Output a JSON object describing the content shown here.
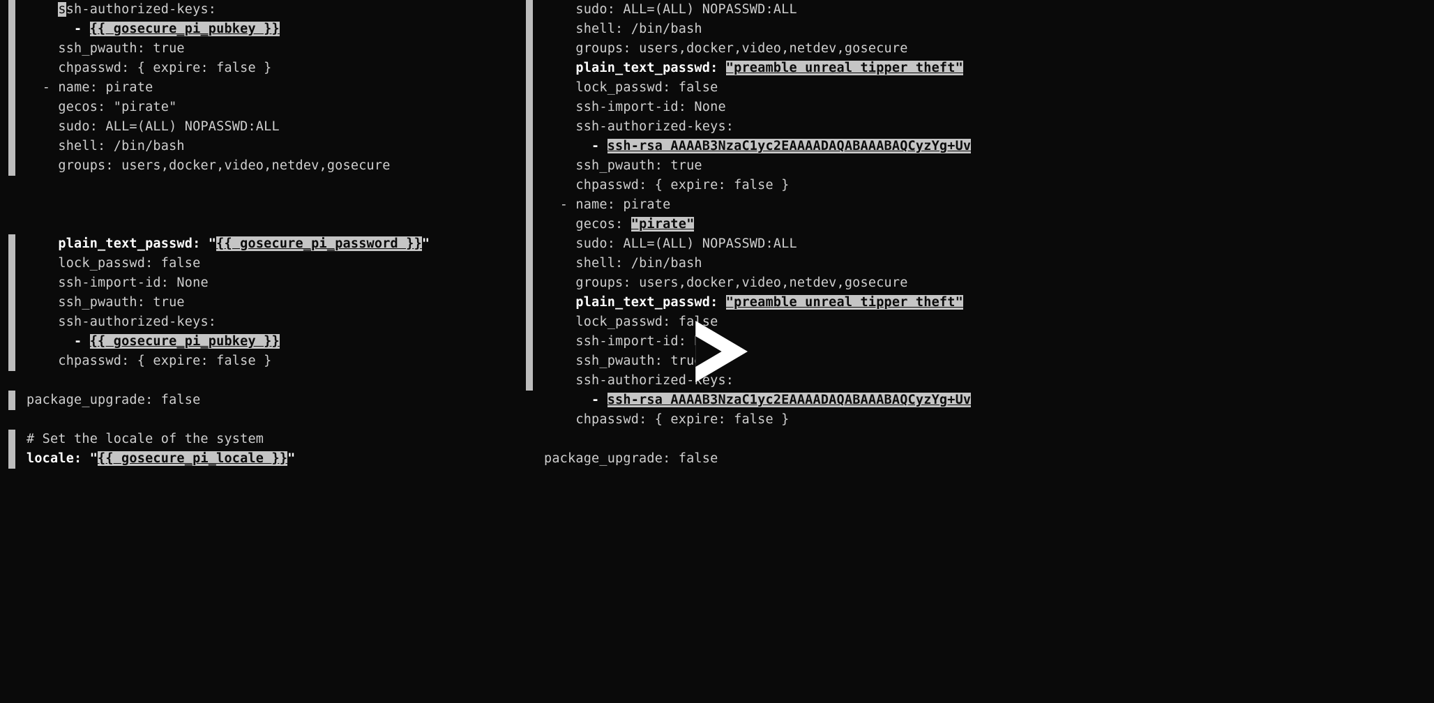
{
  "left": {
    "lines": [
      {
        "gutter": true,
        "indent": 4,
        "segments": [
          {
            "t": "s",
            "cls": "cursor"
          },
          {
            "t": "sh-authorized-keys:"
          }
        ]
      },
      {
        "gutter": true,
        "indent": 6,
        "segments": [
          {
            "t": "- ",
            "cls": "bold"
          },
          {
            "t": "{{ gosecure_pi_pubkey }}",
            "cls": "hl bold u"
          }
        ]
      },
      {
        "gutter": true,
        "indent": 4,
        "segments": [
          {
            "t": "ssh_pwauth: true"
          }
        ]
      },
      {
        "gutter": true,
        "indent": 4,
        "segments": [
          {
            "t": "chpasswd: { expire: false }"
          }
        ]
      },
      {
        "gutter": true,
        "indent": 2,
        "segments": [
          {
            "t": "- name: pirate"
          }
        ]
      },
      {
        "gutter": true,
        "indent": 4,
        "segments": [
          {
            "t": "gecos: \"pirate\""
          }
        ]
      },
      {
        "gutter": true,
        "indent": 4,
        "segments": [
          {
            "t": "sudo: ALL=(ALL) NOPASSWD:ALL"
          }
        ]
      },
      {
        "gutter": true,
        "indent": 4,
        "segments": [
          {
            "t": "shell: /bin/bash"
          }
        ]
      },
      {
        "gutter": true,
        "indent": 4,
        "segments": [
          {
            "t": "groups: users,docker,video,netdev,gosecure"
          }
        ]
      },
      {
        "gutter": false,
        "indent": 0,
        "segments": []
      },
      {
        "gutter": false,
        "indent": 0,
        "segments": []
      },
      {
        "gutter": false,
        "indent": 0,
        "segments": []
      },
      {
        "gutter": true,
        "indent": 4,
        "segments": [
          {
            "t": "plain_text_passwd: \"",
            "cls": "bold"
          },
          {
            "t": "{{ gosecure_pi_password }}",
            "cls": "hl bold u"
          },
          {
            "t": "\"",
            "cls": "bold"
          }
        ]
      },
      {
        "gutter": true,
        "indent": 4,
        "segments": [
          {
            "t": "lock_passwd: false"
          }
        ]
      },
      {
        "gutter": true,
        "indent": 4,
        "segments": [
          {
            "t": "ssh-import-id: None"
          }
        ]
      },
      {
        "gutter": true,
        "indent": 4,
        "segments": [
          {
            "t": "ssh_pwauth: true"
          }
        ]
      },
      {
        "gutter": true,
        "indent": 4,
        "segments": [
          {
            "t": "ssh-authorized-keys:"
          }
        ]
      },
      {
        "gutter": true,
        "indent": 6,
        "segments": [
          {
            "t": "- ",
            "cls": "bold"
          },
          {
            "t": "{{ gosecure_pi_pubkey }}",
            "cls": "hl bold u"
          }
        ]
      },
      {
        "gutter": true,
        "indent": 4,
        "segments": [
          {
            "t": "chpasswd: { expire: false }"
          }
        ]
      },
      {
        "gutter": false,
        "indent": 0,
        "segments": []
      },
      {
        "gutter": true,
        "indent": 0,
        "segments": [
          {
            "t": "package_upgrade: false"
          }
        ]
      },
      {
        "gutter": false,
        "indent": 0,
        "segments": []
      },
      {
        "gutter": true,
        "indent": 0,
        "segments": [
          {
            "t": "# Set the locale of the system"
          }
        ]
      },
      {
        "gutter": true,
        "indent": 0,
        "segments": [
          {
            "t": "locale: \"",
            "cls": "bold"
          },
          {
            "t": "{{ gosecure_pi_locale }}",
            "cls": "hl bold u"
          },
          {
            "t": "\"",
            "cls": "bold"
          }
        ]
      }
    ]
  },
  "right": {
    "lines": [
      {
        "gutter": true,
        "indent": 4,
        "segments": [
          {
            "t": "sudo: ALL=(ALL) NOPASSWD:ALL"
          }
        ]
      },
      {
        "gutter": true,
        "indent": 4,
        "segments": [
          {
            "t": "shell: /bin/bash"
          }
        ]
      },
      {
        "gutter": true,
        "indent": 4,
        "segments": [
          {
            "t": "groups: users,docker,video,netdev,gosecure"
          }
        ]
      },
      {
        "gutter": true,
        "indent": 4,
        "segments": [
          {
            "t": "plain_text_passwd: ",
            "cls": "bold"
          },
          {
            "t": "\"preamble unreal tipper theft\"",
            "cls": "hl bold u"
          }
        ]
      },
      {
        "gutter": true,
        "indent": 4,
        "segments": [
          {
            "t": "lock_passwd: false"
          }
        ]
      },
      {
        "gutter": true,
        "indent": 4,
        "segments": [
          {
            "t": "ssh-import-id: None"
          }
        ]
      },
      {
        "gutter": true,
        "indent": 4,
        "segments": [
          {
            "t": "ssh-authorized-keys:"
          }
        ]
      },
      {
        "gutter": true,
        "indent": 6,
        "segments": [
          {
            "t": "- ",
            "cls": "bold"
          },
          {
            "t": "ssh-rsa AAAAB3NzaC1yc2EAAAADAQABAAABAQCyzYg+Uv",
            "cls": "hl bold"
          }
        ]
      },
      {
        "gutter": true,
        "indent": 4,
        "segments": [
          {
            "t": "ssh_pwauth: true"
          }
        ]
      },
      {
        "gutter": true,
        "indent": 4,
        "segments": [
          {
            "t": "chpasswd: { expire: false }"
          }
        ]
      },
      {
        "gutter": true,
        "indent": 2,
        "segments": [
          {
            "t": "- name: pirate"
          }
        ]
      },
      {
        "gutter": true,
        "indent": 4,
        "segments": [
          {
            "t": "gecos: "
          },
          {
            "t": "\"pirate\"",
            "cls": "hl bold u"
          }
        ]
      },
      {
        "gutter": true,
        "indent": 4,
        "segments": [
          {
            "t": "sudo: ALL=(ALL) NOPASSWD:ALL"
          }
        ]
      },
      {
        "gutter": true,
        "indent": 4,
        "segments": [
          {
            "t": "shell: /bin/bash"
          }
        ]
      },
      {
        "gutter": true,
        "indent": 4,
        "segments": [
          {
            "t": "groups: users,docker,video,netdev,gosecure"
          }
        ]
      },
      {
        "gutter": true,
        "indent": 4,
        "segments": [
          {
            "t": "plain_text_passwd: ",
            "cls": "bold"
          },
          {
            "t": "\"preamble unreal tipper theft\"",
            "cls": "hl bold u"
          }
        ]
      },
      {
        "gutter": true,
        "indent": 4,
        "segments": [
          {
            "t": "lock_passwd: false"
          }
        ]
      },
      {
        "gutter": true,
        "indent": 4,
        "segments": [
          {
            "t": "ssh-import-id: None"
          }
        ]
      },
      {
        "gutter": true,
        "indent": 4,
        "segments": [
          {
            "t": "ssh_pwauth: true"
          }
        ]
      },
      {
        "gutter": true,
        "indent": 4,
        "segments": [
          {
            "t": "ssh-authorized-keys:"
          }
        ]
      },
      {
        "gutter": false,
        "indent": 6,
        "segments": [
          {
            "t": "- ",
            "cls": "bold"
          },
          {
            "t": "ssh-rsa AAAAB3NzaC1yc2EAAAADAQABAAABAQCyzYg+Uv",
            "cls": "hl bold"
          }
        ]
      },
      {
        "gutter": false,
        "indent": 4,
        "segments": [
          {
            "t": "chpasswd: { expire: false }"
          }
        ]
      },
      {
        "gutter": false,
        "indent": 0,
        "segments": []
      },
      {
        "gutter": false,
        "indent": 0,
        "segments": [
          {
            "t": "package_upgrade: false"
          }
        ]
      }
    ]
  },
  "indent_unit": "  "
}
